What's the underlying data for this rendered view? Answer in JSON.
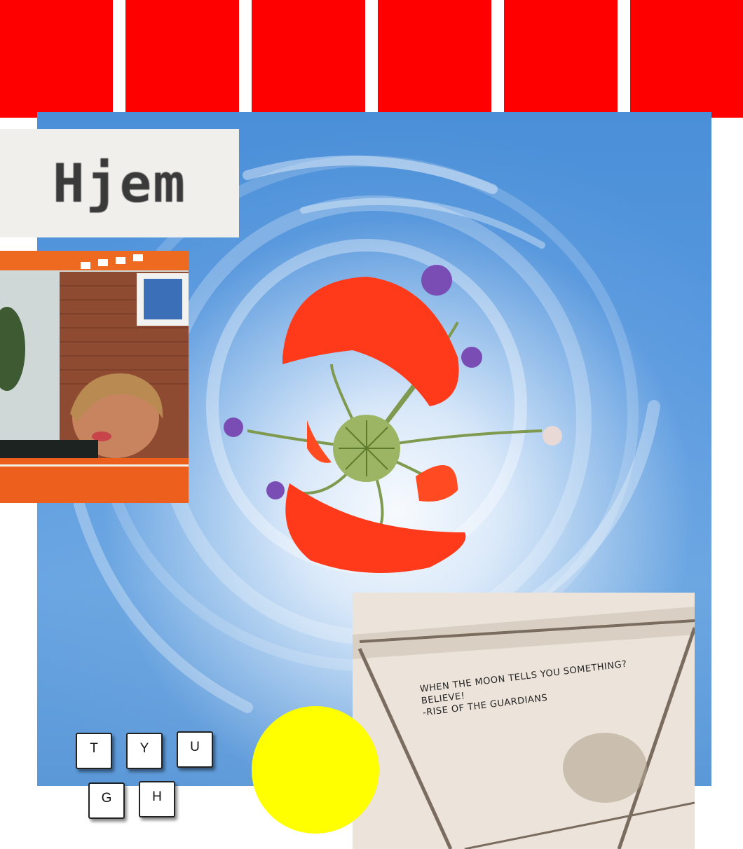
{
  "collage": {
    "title": "Hjem",
    "quote_lines": [
      "WHEN THE MOON TELLS YOU SOMETHING?",
      "BELIEVE!",
      "-RISE OF THE GUARDIANS"
    ],
    "keys": [
      "T",
      "Y",
      "U",
      "G",
      "H"
    ]
  },
  "colors": {
    "bars": "#ff0000",
    "sun": "#ffff00",
    "sky": "#5a9ae0",
    "poppy": "#ff3a1a"
  }
}
